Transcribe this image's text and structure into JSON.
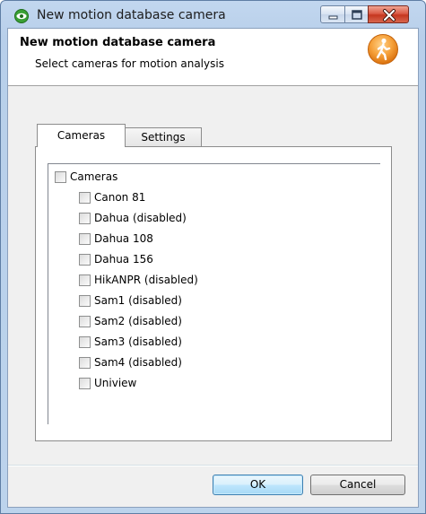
{
  "window": {
    "title": "New motion database camera"
  },
  "header": {
    "title": "New motion database camera",
    "subtitle": "Select cameras for motion analysis"
  },
  "tabs": [
    {
      "label": "Cameras",
      "selected": true
    },
    {
      "label": "Settings",
      "selected": false
    }
  ],
  "tree": {
    "root": {
      "label": "Cameras",
      "checked": false
    },
    "items": [
      {
        "label": "Canon 81",
        "checked": false
      },
      {
        "label": "Dahua (disabled)",
        "checked": false
      },
      {
        "label": "Dahua 108",
        "checked": false
      },
      {
        "label": "Dahua 156",
        "checked": false
      },
      {
        "label": "HikANPR (disabled)",
        "checked": false
      },
      {
        "label": "Sam1 (disabled)",
        "checked": false
      },
      {
        "label": "Sam2 (disabled)",
        "checked": false
      },
      {
        "label": "Sam3 (disabled)",
        "checked": false
      },
      {
        "label": "Sam4 (disabled)",
        "checked": false
      },
      {
        "label": "Uniview",
        "checked": false
      }
    ]
  },
  "buttons": {
    "ok": "OK",
    "cancel": "Cancel"
  },
  "icons": {
    "app": "eye-icon",
    "header": "walking-person-icon",
    "minimize": "minimize-icon",
    "maximize": "maximize-icon",
    "close": "close-icon"
  },
  "colors": {
    "header_icon": "#f28a1e",
    "app_icon": "#3aa035",
    "close_button": "#c5361f"
  }
}
